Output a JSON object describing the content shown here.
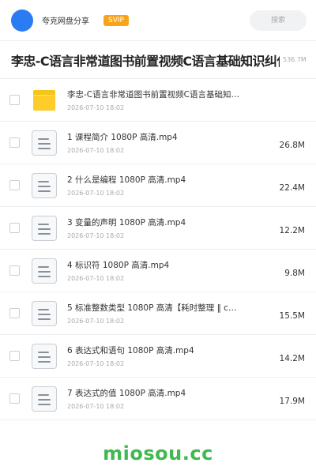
{
  "header": {
    "username": "夸克网盘分享",
    "badge": "SVIP",
    "search_placeholder": "搜索"
  },
  "folder": {
    "title": "李忠-C语言非常道图书前置视频C语言基础知识纠偏",
    "size": "536.7M"
  },
  "items": [
    {
      "type": "folder",
      "icon": "folder-icon",
      "name": "李忠-C语言非常道图书前置视频C语言基础知识纠偏",
      "date": "2026-07-10 18:02",
      "size": ""
    },
    {
      "type": "file",
      "icon": "document-icon",
      "name": "1 课程简介 1080P 高清.mp4",
      "date": "2026-07-10 18:02",
      "size": "26.8M"
    },
    {
      "type": "file",
      "icon": "document-icon",
      "name": "2 什么是编程 1080P 高清.mp4",
      "date": "2026-07-10 18:02",
      "size": "22.4M"
    },
    {
      "type": "file",
      "icon": "document-icon",
      "name": "3 变量的声明 1080P 高清.mp4",
      "date": "2026-07-10 18:02",
      "size": "12.2M"
    },
    {
      "type": "file",
      "icon": "document-icon",
      "name": "4 标识符 1080P 高清.mp4",
      "date": "2026-07-10 18:02",
      "size": "9.8M"
    },
    {
      "type": "file",
      "icon": "document-icon",
      "name": "5 标准整数类型 1080P 高清【耗时整理 ‖ c…",
      "date": "2026-07-10 18:02",
      "size": "15.5M"
    },
    {
      "type": "file",
      "icon": "document-icon",
      "name": "6 表达式和语句 1080P 高清.mp4",
      "date": "2026-07-10 18:02",
      "size": "14.2M"
    },
    {
      "type": "file",
      "icon": "document-icon",
      "name": "7 表达式的值 1080P 高清.mp4",
      "date": "2026-07-10 18:02",
      "size": "17.9M"
    }
  ],
  "watermark": "miosou.cc",
  "colors": {
    "avatar": "#2b7bf3",
    "svip_badge": "#f7a41d",
    "folder": "#ffcc29",
    "watermark": "#3fb950"
  }
}
